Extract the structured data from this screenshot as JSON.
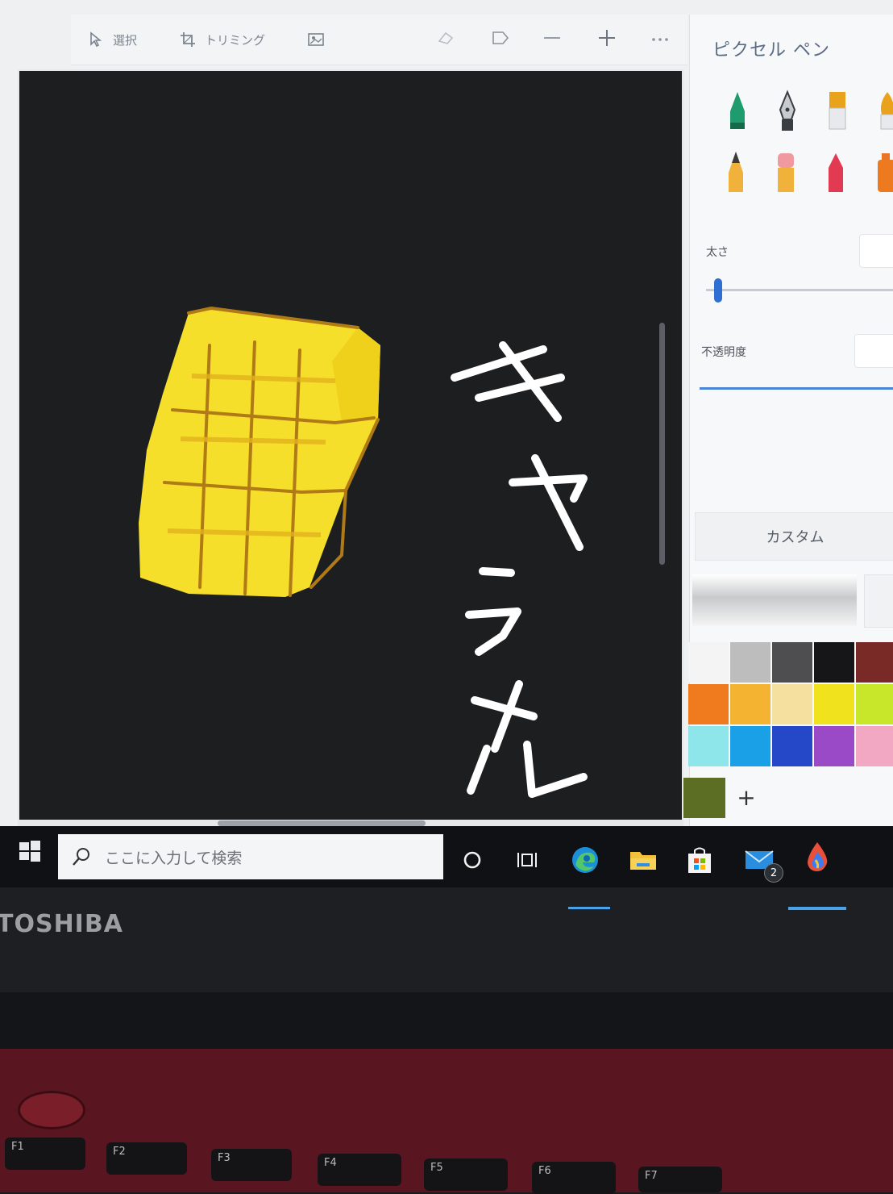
{
  "toolbar": {
    "select_label": "選択",
    "crop_label": "トリミング",
    "icons": [
      "select-icon",
      "crop-icon",
      "image-icon",
      "erase-icon",
      "flip-icon",
      "zoom-out-icon",
      "zoom-in-icon",
      "more-icon"
    ]
  },
  "canvas": {
    "drawing_text": "キャラメル",
    "drawing_colors": {
      "fill": "#f6df2a",
      "stroke": "#b48214",
      "text": "#ffffff",
      "background": "#1d1e20"
    }
  },
  "panel": {
    "title": "ピクセル ペン",
    "thickness_label": "太さ",
    "opacity_label": "不透明度",
    "custom_label": "カスタム",
    "add_color": "+",
    "swatch_colors": [
      [
        "#f4f4f4",
        "#bdbdbd",
        "#4e4e50",
        "#161618",
        "#7a2a26"
      ],
      [
        "#f07a1e",
        "#f4b432",
        "#f6e0a0",
        "#f1e21e",
        "#c8e62a"
      ],
      [
        "#8fe6ea",
        "#1aa0e6",
        "#2548c8",
        "#9a4ac6",
        "#f2a8c2"
      ]
    ],
    "custom_swatch": "#5c6e24"
  },
  "taskbar": {
    "search_placeholder": "ここに入力して検索",
    "mail_badge": "2",
    "icons": [
      "windows-start-icon",
      "cortana-icon",
      "task-view-icon",
      "edge-icon",
      "file-explorer-icon",
      "store-icon",
      "mail-icon",
      "fresh-paint-icon"
    ]
  },
  "device": {
    "brand": "TOSHIBA",
    "function_keys": [
      "F1",
      "F2",
      "F3",
      "F4",
      "F5",
      "F6",
      "F7"
    ]
  }
}
